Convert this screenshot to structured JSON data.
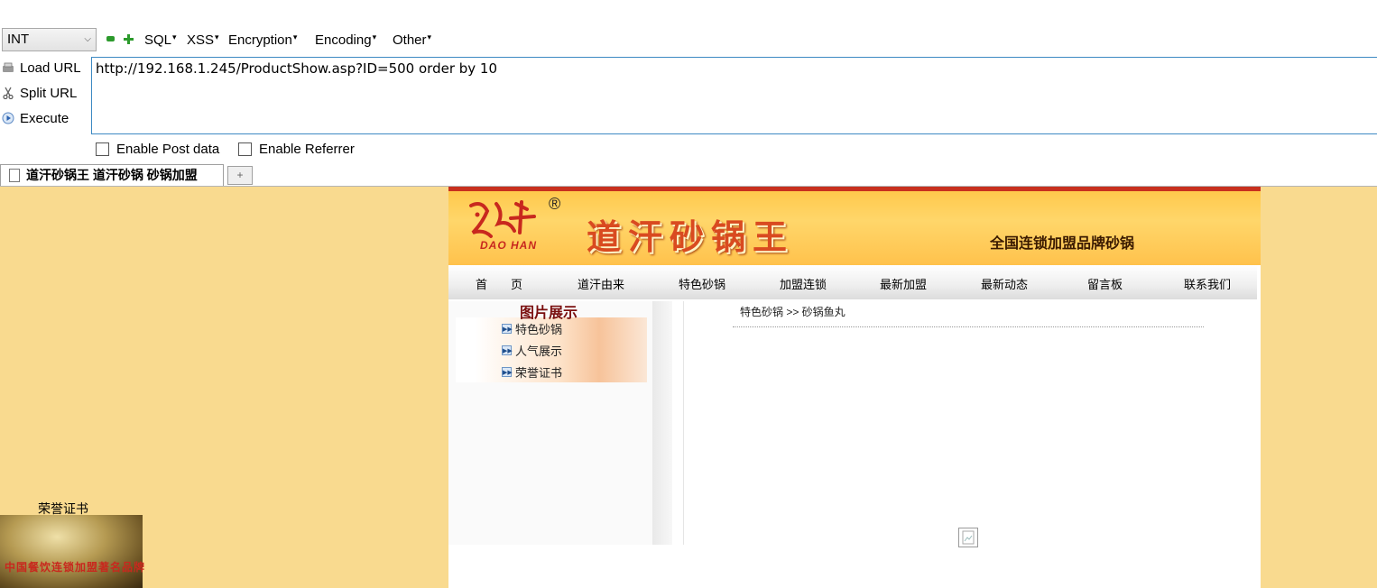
{
  "hackbar": {
    "type_select": "INT",
    "menus": [
      "SQL",
      "XSS",
      "Encryption",
      "Encoding",
      "Other"
    ],
    "load_url": "Load URL",
    "split_url": "Split URL",
    "execute": "Execute",
    "url": "http://192.168.1.245/ProductShow.asp?ID=500 order by 10",
    "enable_post": "Enable Post data",
    "enable_referrer": "Enable Referrer"
  },
  "tabs": {
    "active_title": "道汗砂锅王 道汗砂锅 砂锅加盟",
    "new_tab": "+"
  },
  "site": {
    "logo_text": "DAO HAN",
    "registered": "®",
    "title": "道汗砂锅王",
    "slogan": "全国连锁加盟品牌砂锅",
    "nav": [
      "首　　页",
      "道汗由来",
      "特色砂锅",
      "加盟连锁",
      "最新加盟",
      "最新动态",
      "留言板",
      "联系我们"
    ],
    "category_title": "图片展示",
    "categories": [
      "特色砂锅",
      "人气展示",
      "荣誉证书"
    ],
    "breadcrumb": "特色砂锅 >> 砂锅鱼丸",
    "honor_label": "荣誉证书",
    "honor_image_text": "中国餐饮连锁加盟著名品牌"
  },
  "colors": {
    "page_bg": "#f9da8f",
    "banner": "#ffc94c",
    "title": "#d94a20",
    "category_title": "#7a0f0f",
    "url_border": "#3d89c3"
  }
}
